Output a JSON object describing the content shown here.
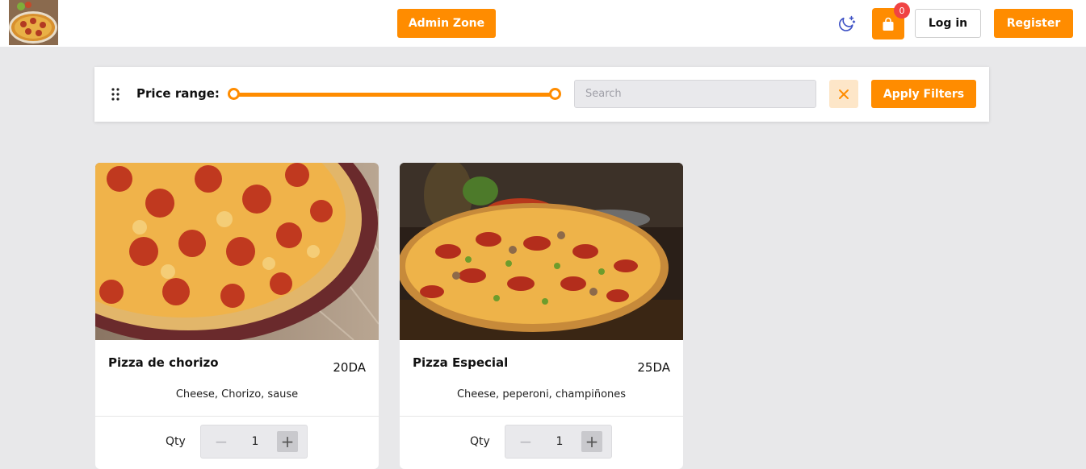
{
  "header": {
    "logo_icon": "pizza-logo-icon",
    "admin_label": "Admin Zone",
    "theme_icon": "moon-stars-icon",
    "cart_icon": "shopping-bag-icon",
    "cart_count": "0",
    "login_label": "Log in",
    "register_label": "Register"
  },
  "filters": {
    "drag_icon": "drag-dots-icon",
    "price_label": "Price range:",
    "search_placeholder": "Search",
    "clear_icon": "close-icon",
    "apply_label": "Apply Filters"
  },
  "products": [
    {
      "name": "Pizza de chorizo",
      "price": "20DA",
      "description": "Cheese, Chorizo, sause",
      "qty_label": "Qty",
      "qty_value": "1"
    },
    {
      "name": "Pizza Especial",
      "price": "25DA",
      "description": "Cheese, peperoni, champiñones",
      "qty_label": "Qty",
      "qty_value": "1"
    }
  ],
  "colors": {
    "accent": "#ff8c00",
    "badge": "#f04343",
    "background": "#e8e8ea",
    "theme_icon": "#3b4fc4"
  }
}
